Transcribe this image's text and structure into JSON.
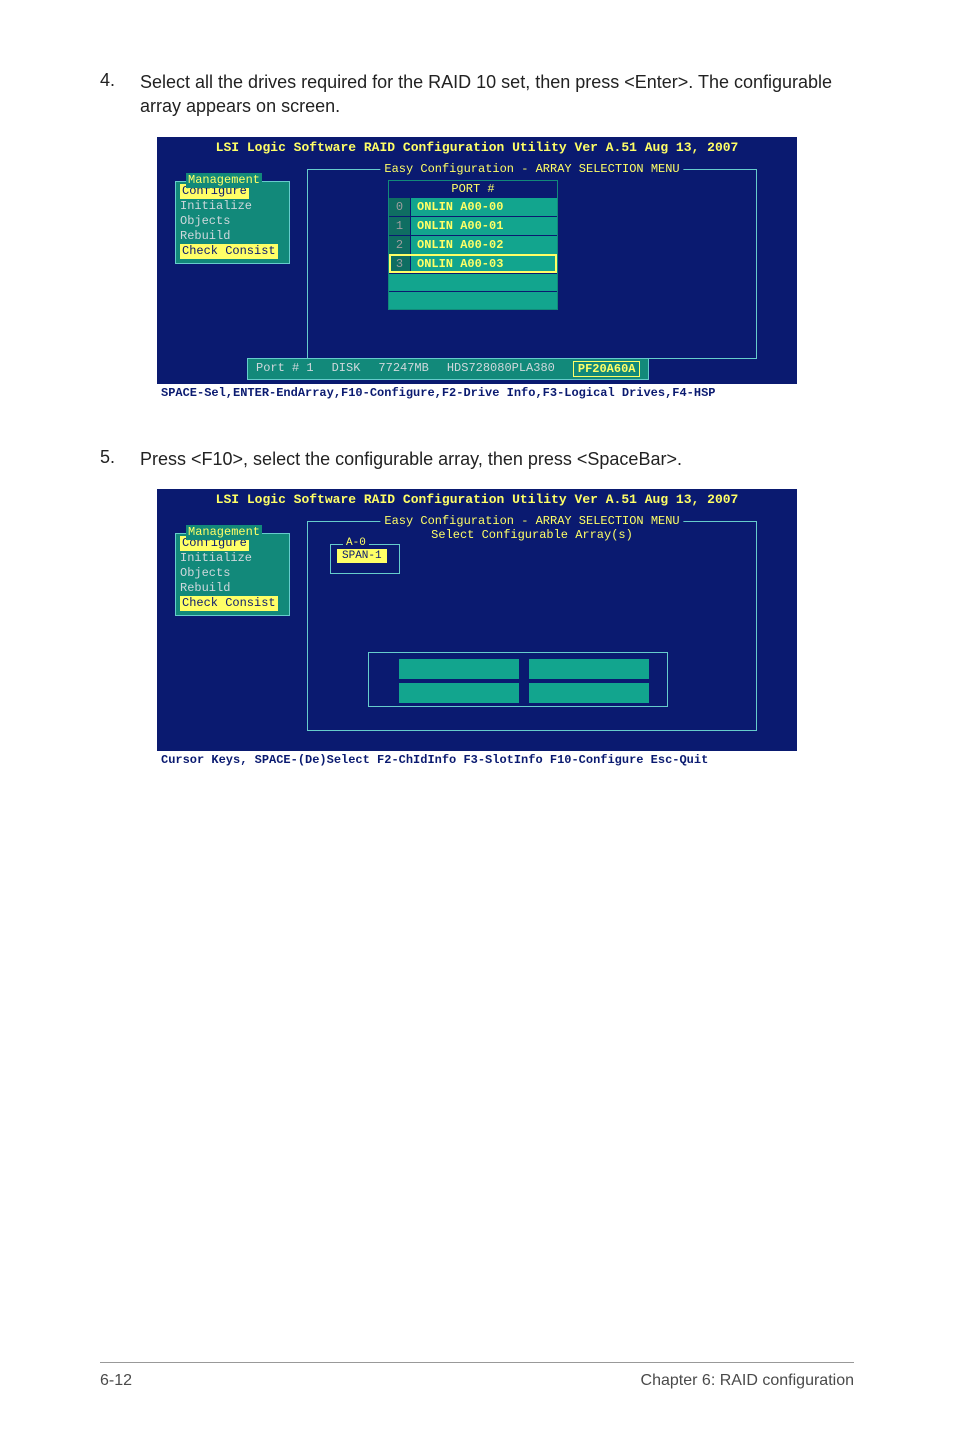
{
  "step4": {
    "num": "4.",
    "text": "Select all the drives required for the RAID 10 set, then press <Enter>. The configurable array appears on screen."
  },
  "step5": {
    "num": "5.",
    "text": "Press <F10>, select the configurable array, then press <SpaceBar>."
  },
  "bios1": {
    "title": "LSI Logic Software RAID Configuration Utility Ver A.51 Aug 13, 2007",
    "easy_title": "Easy Configuration - ARRAY SELECTION MENU",
    "mgmt_title": "Management",
    "menu": {
      "configure": "Configure",
      "initialize": "Initialize",
      "objects": "Objects",
      "rebuild": "Rebuild",
      "check": "Check Consist"
    },
    "port_header": "PORT #",
    "ports": [
      {
        "n": "0",
        "v": "ONLIN A00-00"
      },
      {
        "n": "1",
        "v": "ONLIN A00-01"
      },
      {
        "n": "2",
        "v": "ONLIN A00-02"
      },
      {
        "n": "3",
        "v": "ONLIN A00-03"
      }
    ],
    "disk": {
      "port": "Port # 1",
      "type": "DISK",
      "size": "77247MB",
      "model": "HDS728080PLA380",
      "fw": "PF20A60A"
    },
    "footer": "SPACE-Sel,ENTER-EndArray,F10-Configure,F2-Drive Info,F3-Logical Drives,F4-HSP"
  },
  "bios2": {
    "title": "LSI Logic Software RAID Configuration Utility Ver A.51 Aug 13, 2007",
    "easy_title": "Easy Configuration - ARRAY SELECTION MENU",
    "sel_title": "Select Configurable Array(s)",
    "mgmt_title": "Management",
    "menu": {
      "configure": "Configure",
      "initialize": "Initialize",
      "objects": "Objects",
      "rebuild": "Rebuild",
      "check": "Check Consist"
    },
    "a0": "A-0",
    "span": "SPAN-1",
    "footer": "Cursor Keys, SPACE-(De)Select F2-ChIdInfo F3-SlotInfo F10-Configure Esc-Quit"
  },
  "footer": {
    "left": "6-12",
    "right": "Chapter 6: RAID configuration"
  }
}
